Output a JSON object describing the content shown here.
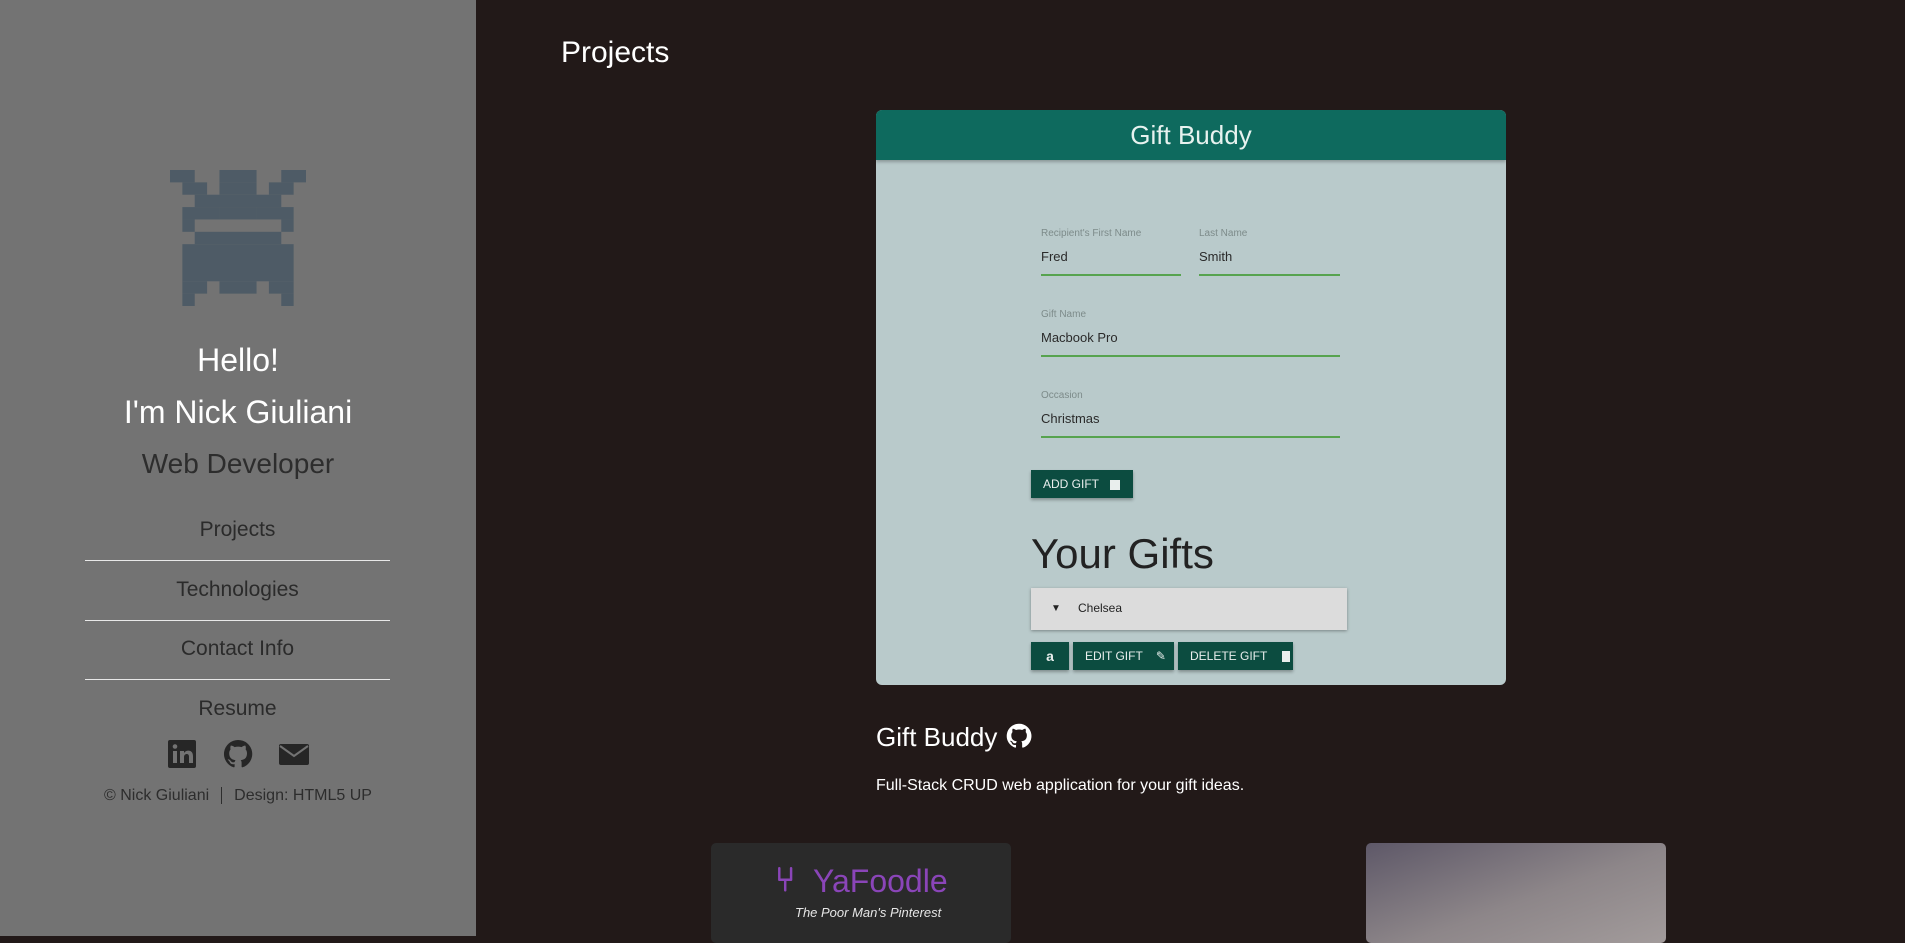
{
  "sidebar": {
    "greeting_1": "Hello!",
    "greeting_2": "I'm Nick Giuliani",
    "role": "Web Developer",
    "nav": [
      {
        "label": "Projects"
      },
      {
        "label": "Technologies"
      },
      {
        "label": "Contact Info"
      },
      {
        "label": "Resume"
      }
    ],
    "social": [
      "linkedin-icon",
      "github-icon",
      "envelope-icon"
    ],
    "footer_copyright": "© Nick Giuliani",
    "footer_design": "Design: HTML5 UP"
  },
  "main": {
    "section_title": "Projects",
    "projects": [
      {
        "title": "Gift Buddy",
        "description": "Full-Stack CRUD web application for your gift ideas.",
        "screenshot": {
          "header": "Gift Buddy",
          "fields": [
            {
              "label": "Recipient's First Name",
              "value": "Fred"
            },
            {
              "label": "Last Name",
              "value": "Smith"
            },
            {
              "label": "Gift Name",
              "value": "Macbook Pro"
            },
            {
              "label": "Occasion",
              "value": "Christmas"
            }
          ],
          "add_button": "ADD GIFT",
          "list_heading": "Your Gifts",
          "gift_row_name": "Chelsea",
          "edit_button": "EDIT GIFT",
          "delete_button": "DELETE GIFT"
        }
      },
      {
        "logo_text": "YaFoodle",
        "tagline": "The Poor Man's Pinterest"
      }
    ]
  },
  "colors": {
    "sidebar_bg": "#737373",
    "main_bg": "#221918",
    "app_header": "#0e6a5e",
    "app_button": "#0c4c40",
    "field_underline": "#57a34f",
    "yafoodle_purple": "#8a45b8"
  }
}
